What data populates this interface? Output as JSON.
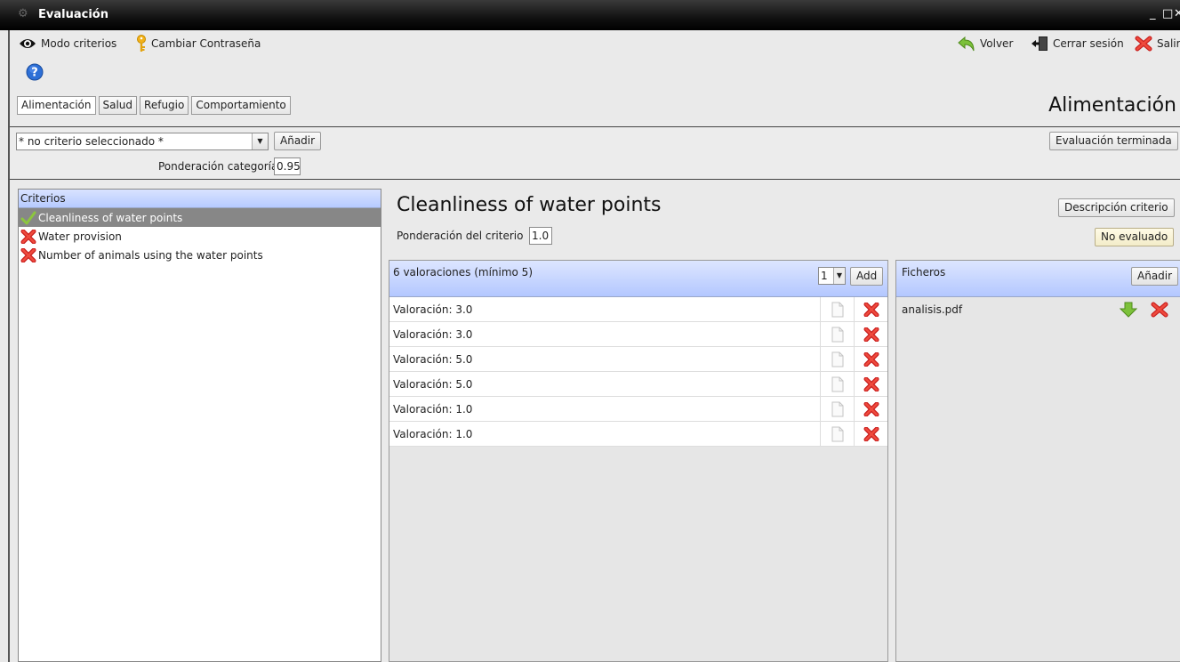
{
  "window": {
    "title": "Evaluación",
    "controls": [
      "_",
      "□",
      "✕"
    ]
  },
  "toolbar": {
    "criteria_mode": "Modo criterios",
    "change_password": "Cambiar Contraseña",
    "back": "Volver",
    "logout": "Cerrar sesión",
    "exit": "Salir"
  },
  "tabs": [
    {
      "label": "Alimentación",
      "active": true
    },
    {
      "label": "Salud"
    },
    {
      "label": "Refugio"
    },
    {
      "label": "Comportamiento"
    }
  ],
  "section_title": "Alimentación",
  "filter": {
    "combo_value": "* no criterio seleccionado *",
    "add_label": "Añadir",
    "weight_label": "Ponderación categoría",
    "weight_value": "0.95",
    "finish_label": "Evaluación terminada"
  },
  "criteria": {
    "header": "Criterios",
    "items": [
      {
        "label": "Cleanliness of water points",
        "status": "ok",
        "selected": true
      },
      {
        "label": "Water provision",
        "status": "missing"
      },
      {
        "label": "Number of animals using the water points",
        "status": "missing"
      }
    ]
  },
  "detail": {
    "title": "Cleanliness of water points",
    "weight_label": "Ponderación del criterio",
    "weight_value": "1.0",
    "description_button": "Descripción criterio",
    "status_button": "No evaluado"
  },
  "valuations": {
    "header": "6 valoraciones (mínimo 5)",
    "spinner_value": "1",
    "add_label": "Add",
    "rows": [
      {
        "label": "Valoración: 3.0"
      },
      {
        "label": "Valoración: 3.0"
      },
      {
        "label": "Valoración: 5.0"
      },
      {
        "label": "Valoración: 5.0"
      },
      {
        "label": "Valoración: 1.0"
      },
      {
        "label": "Valoración: 1.0"
      }
    ]
  },
  "files": {
    "header": "Ficheros",
    "add_label": "Añadir",
    "items": [
      {
        "name": "analisis.pdf"
      }
    ]
  },
  "colors": {
    "selection": "#878787",
    "header_blue": "#b6caff",
    "delete_red": "#d6262b",
    "ok_green": "#8cc63e"
  }
}
